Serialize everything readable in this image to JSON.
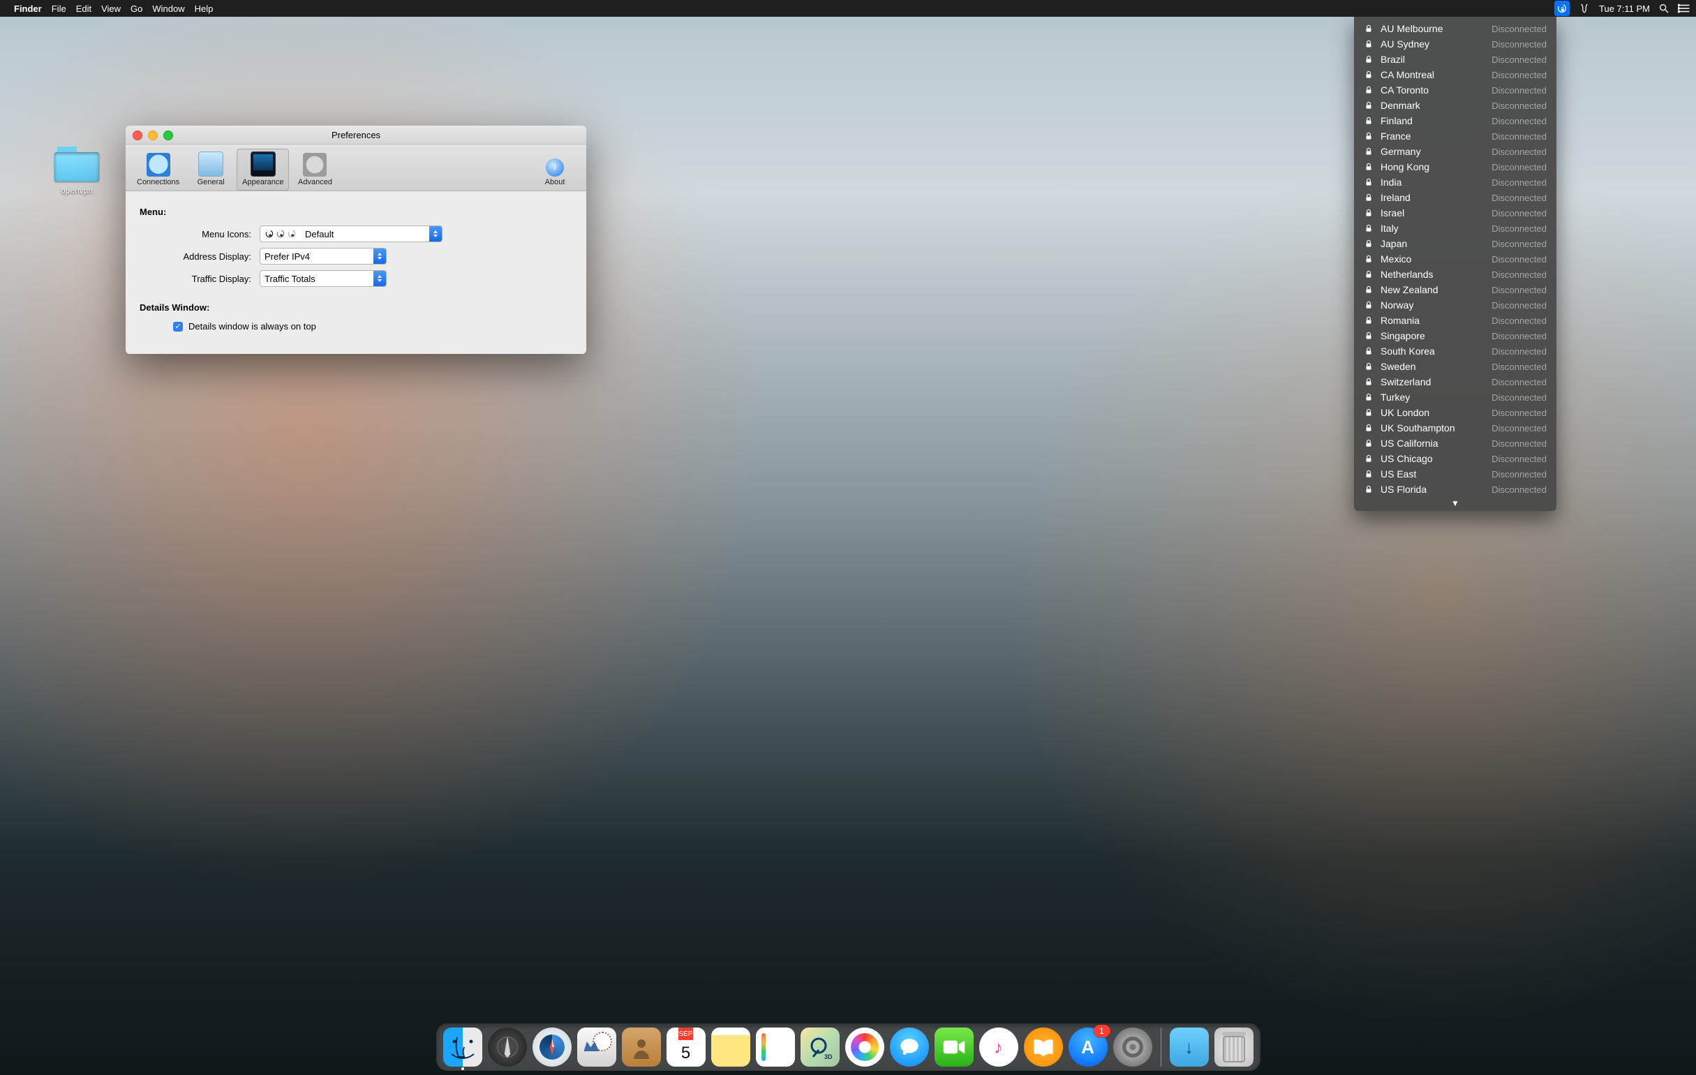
{
  "menubar": {
    "app": "Finder",
    "items": [
      "File",
      "Edit",
      "View",
      "Go",
      "Window",
      "Help"
    ],
    "clock": "Tue 7:11 PM"
  },
  "desktop": {
    "folder_name": "openvpn"
  },
  "window": {
    "title": "Preferences",
    "toolbar": {
      "connections": "Connections",
      "general": "General",
      "appearance": "Appearance",
      "advanced": "Advanced",
      "about": "About"
    },
    "sections": {
      "menu_label": "Menu:",
      "details_label": "Details Window:"
    },
    "fields": {
      "menu_icons_label": "Menu Icons:",
      "menu_icons_value": "Default",
      "address_display_label": "Address Display:",
      "address_display_value": "Prefer IPv4",
      "traffic_display_label": "Traffic Display:",
      "traffic_display_value": "Traffic Totals",
      "details_on_top_label": "Details window is always on top",
      "details_on_top_checked": true
    }
  },
  "vpn_menu": {
    "items": [
      {
        "name": "AU Melbourne",
        "status": "Disconnected"
      },
      {
        "name": "AU Sydney",
        "status": "Disconnected"
      },
      {
        "name": "Brazil",
        "status": "Disconnected"
      },
      {
        "name": "CA Montreal",
        "status": "Disconnected"
      },
      {
        "name": "CA Toronto",
        "status": "Disconnected"
      },
      {
        "name": "Denmark",
        "status": "Disconnected"
      },
      {
        "name": "Finland",
        "status": "Disconnected"
      },
      {
        "name": "France",
        "status": "Disconnected"
      },
      {
        "name": "Germany",
        "status": "Disconnected"
      },
      {
        "name": "Hong Kong",
        "status": "Disconnected"
      },
      {
        "name": "India",
        "status": "Disconnected"
      },
      {
        "name": "Ireland",
        "status": "Disconnected"
      },
      {
        "name": "Israel",
        "status": "Disconnected"
      },
      {
        "name": "Italy",
        "status": "Disconnected"
      },
      {
        "name": "Japan",
        "status": "Disconnected"
      },
      {
        "name": "Mexico",
        "status": "Disconnected"
      },
      {
        "name": "Netherlands",
        "status": "Disconnected"
      },
      {
        "name": "New Zealand",
        "status": "Disconnected"
      },
      {
        "name": "Norway",
        "status": "Disconnected"
      },
      {
        "name": "Romania",
        "status": "Disconnected"
      },
      {
        "name": "Singapore",
        "status": "Disconnected"
      },
      {
        "name": "South Korea",
        "status": "Disconnected"
      },
      {
        "name": "Sweden",
        "status": "Disconnected"
      },
      {
        "name": "Switzerland",
        "status": "Disconnected"
      },
      {
        "name": "Turkey",
        "status": "Disconnected"
      },
      {
        "name": "UK London",
        "status": "Disconnected"
      },
      {
        "name": "UK Southampton",
        "status": "Disconnected"
      },
      {
        "name": "US California",
        "status": "Disconnected"
      },
      {
        "name": "US Chicago",
        "status": "Disconnected"
      },
      {
        "name": "US East",
        "status": "Disconnected"
      },
      {
        "name": "US Florida",
        "status": "Disconnected"
      }
    ]
  },
  "dock": {
    "calendar": {
      "month": "SEP",
      "day": "5"
    },
    "appstore_badge": "1",
    "items": [
      "finder",
      "launchpad",
      "safari",
      "mail",
      "contacts",
      "calendar",
      "notes",
      "reminders",
      "maps",
      "photos",
      "messages",
      "facetime",
      "itunes",
      "ibooks",
      "appstore",
      "settings"
    ],
    "right_items": [
      "downloads",
      "trash"
    ]
  }
}
